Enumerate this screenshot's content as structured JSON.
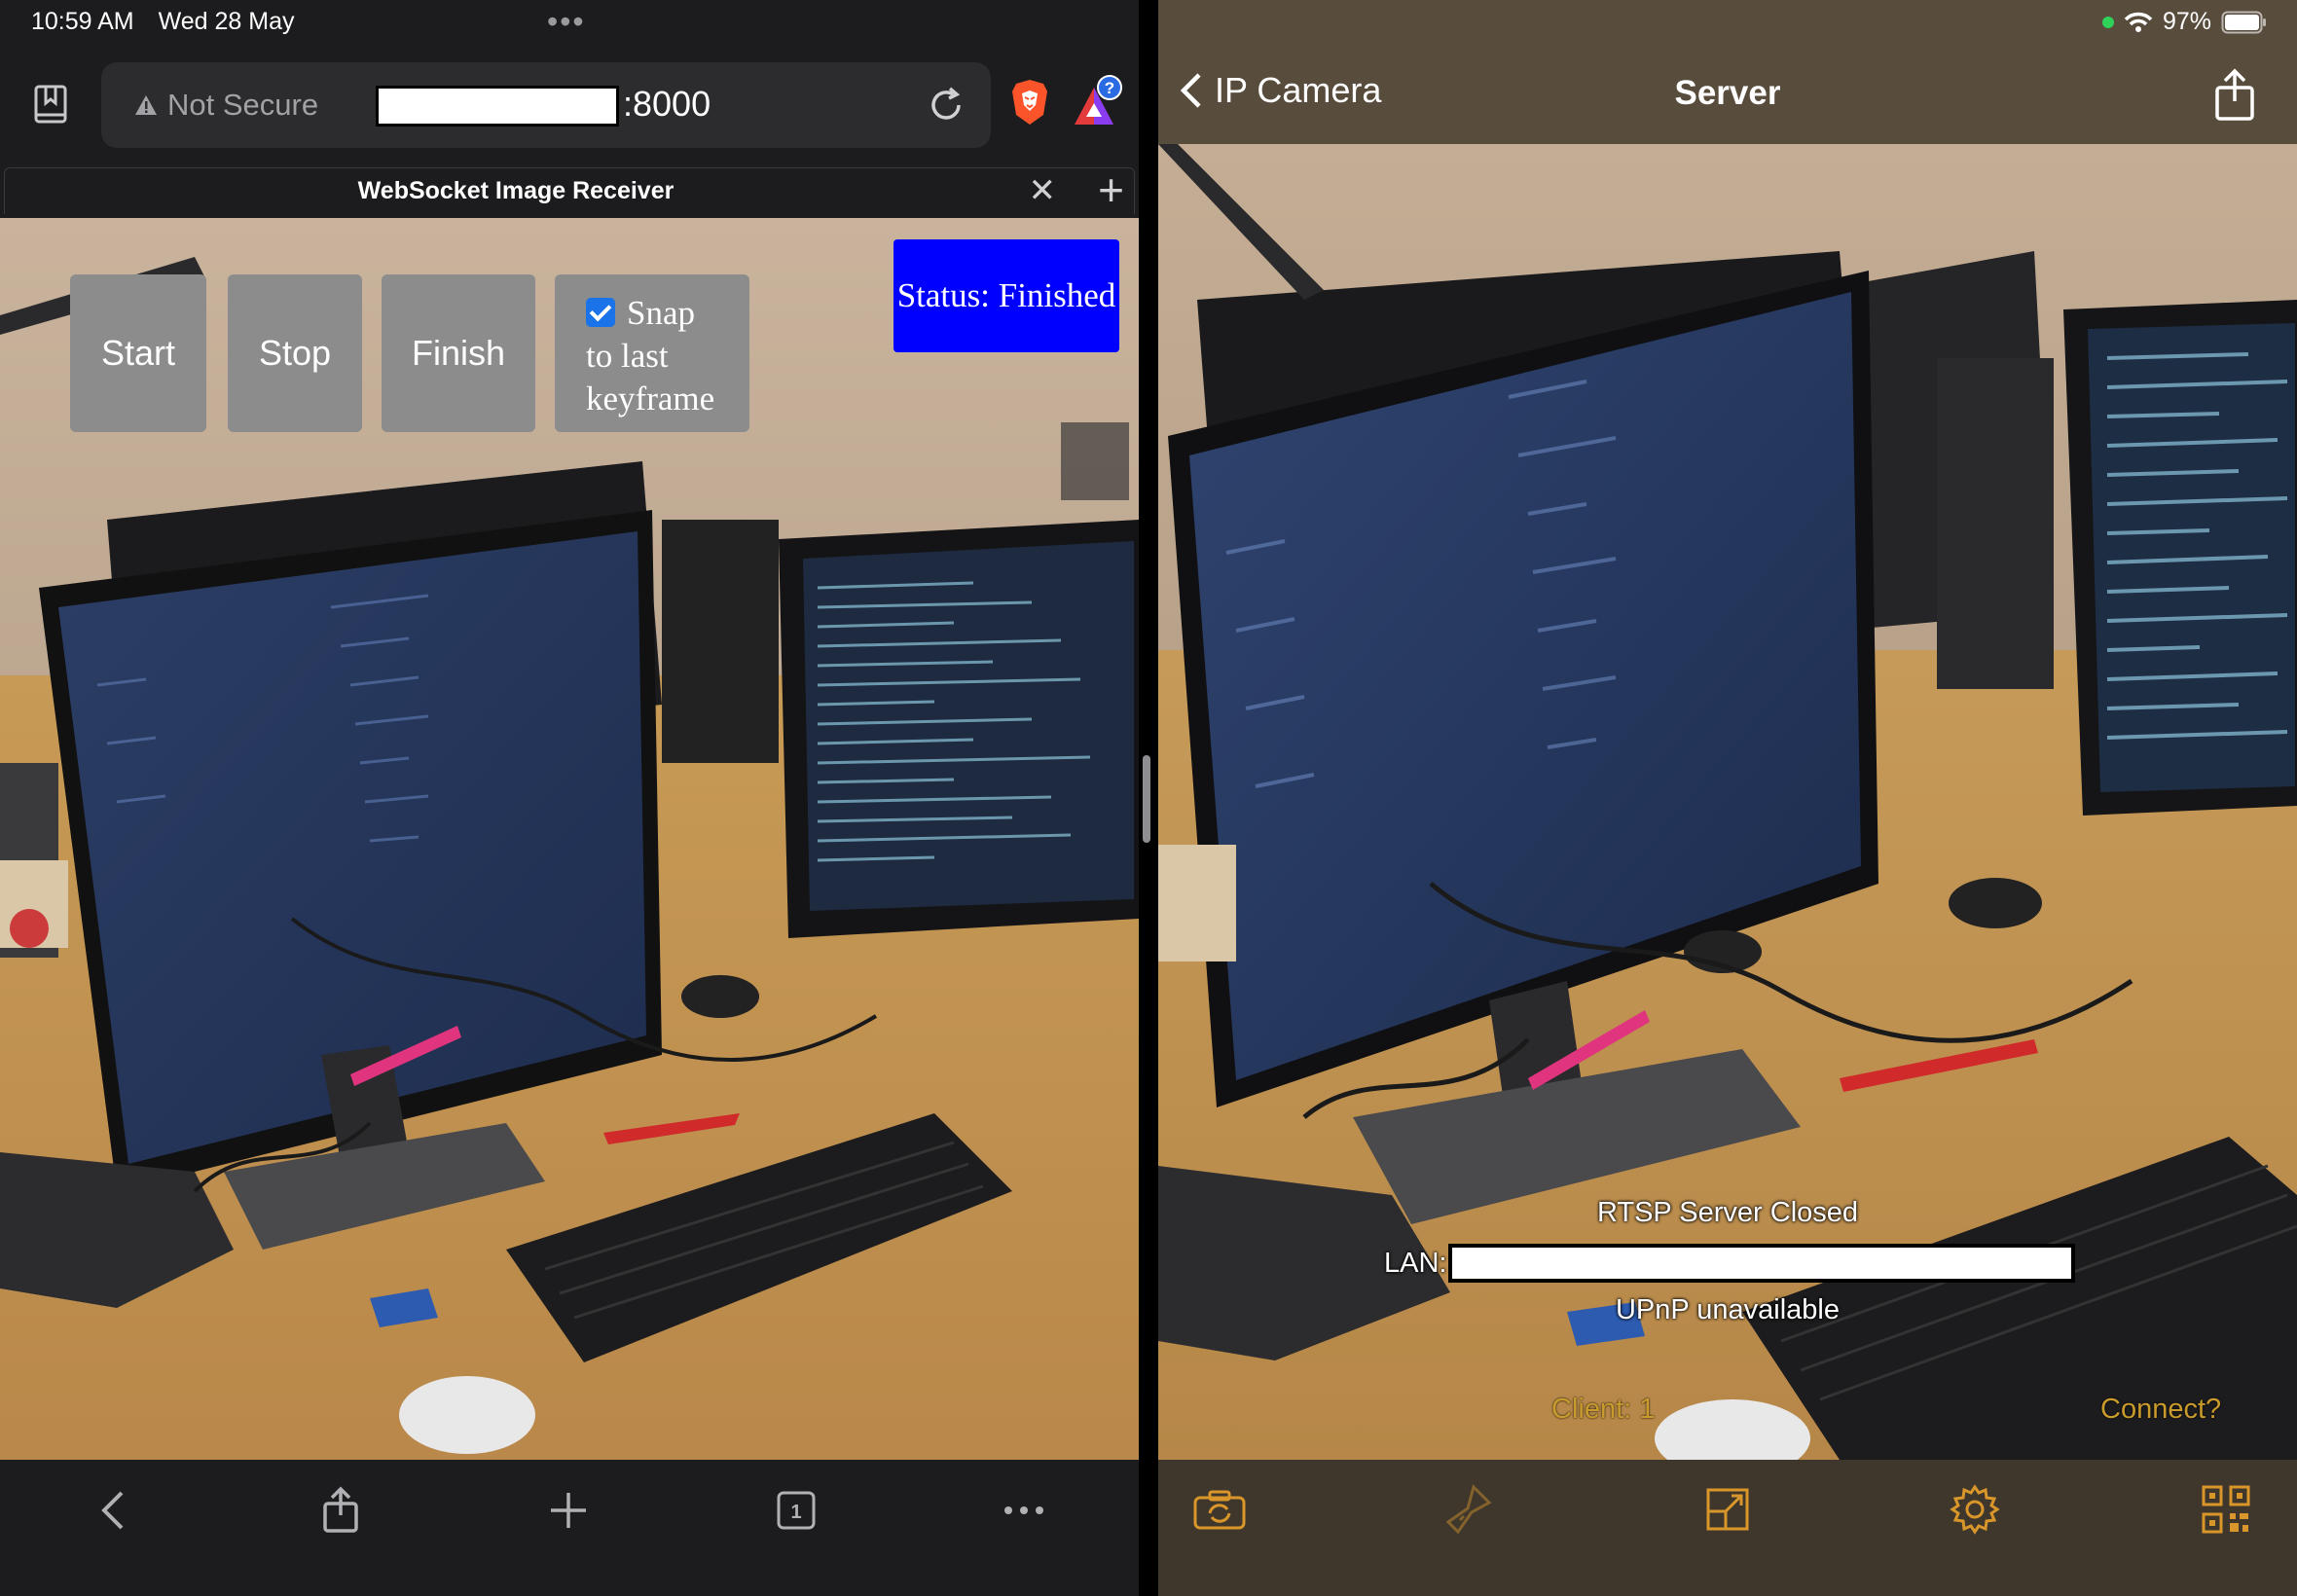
{
  "status_bar": {
    "time": "10:59 AM",
    "date": "Wed 28 May",
    "battery": "97%"
  },
  "browser": {
    "address": {
      "security_label": "Not Secure",
      "port_suffix": ":8000"
    },
    "tab": {
      "title": "WebSocket Image Receiver"
    },
    "icons": [
      "bookmarks-icon",
      "warning-icon",
      "reload-icon",
      "brave-shields-icon",
      "brave-rewards-icon",
      "close-tab-icon",
      "new-tab-icon"
    ],
    "bottom_toolbar": [
      "back-icon",
      "share-icon",
      "add-icon",
      "tabs-icon",
      "more-icon"
    ],
    "tab_count": "1",
    "badge": "?"
  },
  "web_page": {
    "buttons": {
      "start": "Start",
      "stop": "Stop",
      "finish": "Finish"
    },
    "snap": {
      "checked": true,
      "line1": "Snap",
      "line2": "to last",
      "line3": "keyframe"
    },
    "status": "Status: Finished",
    "colors": {
      "button_bg": "#8c8c8c",
      "status_bg": "#0000ff"
    }
  },
  "camera_app": {
    "nav": {
      "back_label": "IP Camera",
      "title": "Server"
    },
    "overlay": {
      "server_status": "RTSP Server Closed",
      "lan_label": "LAN:",
      "upnp": "UPnP unavailable",
      "client": "Client: 1",
      "connect": "Connect?"
    },
    "toolbar": [
      "switch-camera-icon",
      "flashlight-icon",
      "resize-icon",
      "settings-icon",
      "qr-code-icon"
    ],
    "colors": {
      "accent": "#d9962a",
      "nav_bg": "#584c3c"
    }
  }
}
